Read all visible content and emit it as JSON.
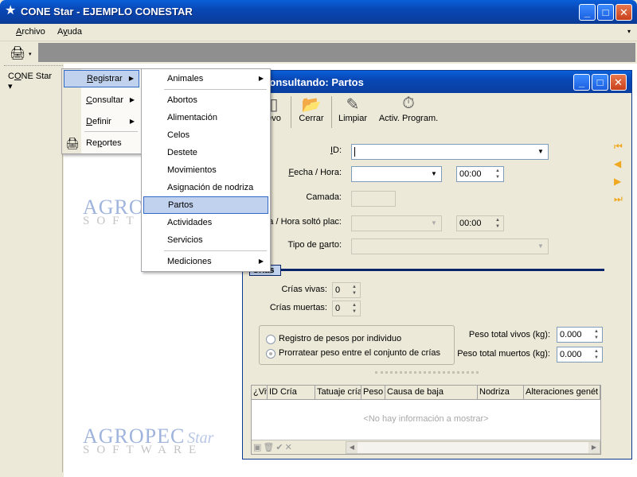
{
  "window": {
    "app_icon": "star-icon",
    "title": "CONE Star - EJEMPLO CONESTAR",
    "min_glyph": "_",
    "max_glyph": "□",
    "close_glyph": "✕"
  },
  "menubar": {
    "archivo": {
      "u": "A",
      "rest": "rchivo"
    },
    "ayuda": {
      "pre": "A",
      "u": "y",
      "rest": "uda"
    },
    "overflow": "▾"
  },
  "toolbar": {
    "printer_icon": "🖨",
    "dropdown": "▾"
  },
  "cone_button": {
    "pre": "C",
    "u": "O",
    "rest": "NE Star ▾"
  },
  "logo": {
    "big": "AGROPEC",
    "small": "SOFTWARE",
    "star": "Star"
  },
  "menu1": {
    "items": [
      {
        "name": "registrar",
        "u": "R",
        "rest": "egistrar",
        "arrow": "▶"
      },
      {
        "name": "consultar",
        "u": "C",
        "rest": "onsultar",
        "arrow": "▶"
      },
      {
        "name": "definir",
        "u": "D",
        "rest": "efinir",
        "arrow": "▶"
      },
      {
        "name": "reportes",
        "pre": "Re",
        "u": "p",
        "rest": "ortes"
      }
    ]
  },
  "menu2": {
    "items": [
      {
        "label": "Animales",
        "arrow": "▶"
      },
      {
        "label": "Abortos"
      },
      {
        "label": "Alimentación"
      },
      {
        "label": "Celos"
      },
      {
        "label": "Destete"
      },
      {
        "label": "Movimientos"
      },
      {
        "label": "Asignación de nodriza"
      },
      {
        "label": "Partos"
      },
      {
        "label": "Actividades"
      },
      {
        "label": "Servicios"
      },
      {
        "label": "Mediciones",
        "arrow": "▶"
      }
    ]
  },
  "child": {
    "title": "Consultando: Partos",
    "tools": {
      "nuevo": "evo",
      "cerrar": "Cerrar",
      "limpiar": "Limpiar",
      "activ": "Activ. Program."
    },
    "form": {
      "id_label": "ID:",
      "fecha_label": "Fecha / Hora:",
      "fecha_time": "00:00",
      "camada_label": "Camada:",
      "placenta_label": "a / Hora soltó plac:",
      "placenta_time": "00:00",
      "tipo_label": "Tipo de parto:"
    },
    "section": "Crías",
    "crias": {
      "vivas_label": "Crías vivas:",
      "vivas_value": "0",
      "muertas_label": "Crías muertas:",
      "muertas_value": "0"
    },
    "radio": {
      "opt1": "Registro de pesos por individuo",
      "opt2": "Prorratear peso entre el conjunto de crías"
    },
    "pesos": {
      "vivos_label": "Peso total vivos (kg):",
      "vivos_value": "0.000",
      "muertos_label": "Peso total muertos (kg):",
      "muertos_value": "0.000"
    },
    "grid": {
      "columns": [
        "¿Viv",
        "ID Cría",
        "Tatuaje cría",
        "Peso",
        "Causa de baja",
        "Nodriza",
        "Alteraciones genét"
      ],
      "empty": "<No hay información a mostrar>",
      "nav_icons": "▣🗑✔✕"
    }
  }
}
